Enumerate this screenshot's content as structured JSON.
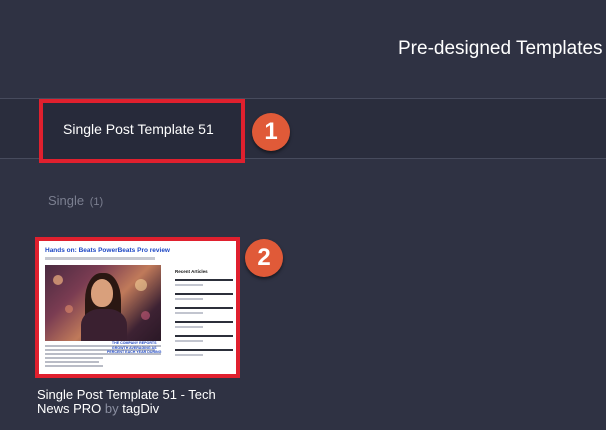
{
  "header": {
    "title": "Pre-designed Templates"
  },
  "tabs": [
    {
      "label": "Single Post Template 51"
    }
  ],
  "markers": {
    "tab": "1",
    "template": "2"
  },
  "category": {
    "label": "Single",
    "count": "(1)"
  },
  "template_card": {
    "name": "Single Post Template 51 - Tech News PRO",
    "by": "by",
    "author": "tagDiv",
    "preview": {
      "headline": "Hands on: Beats PowerBeats Pro review",
      "sidebar_title": "Recent Articles",
      "quote_lines": [
        "THE COMPANY REPORTS",
        "GROWTH AVERAGING AS",
        "PERCENT EACH YEAR DURING"
      ]
    }
  },
  "colors": {
    "background": "#2f3243",
    "highlight": "#e0202e",
    "marker": "#e05a38"
  }
}
